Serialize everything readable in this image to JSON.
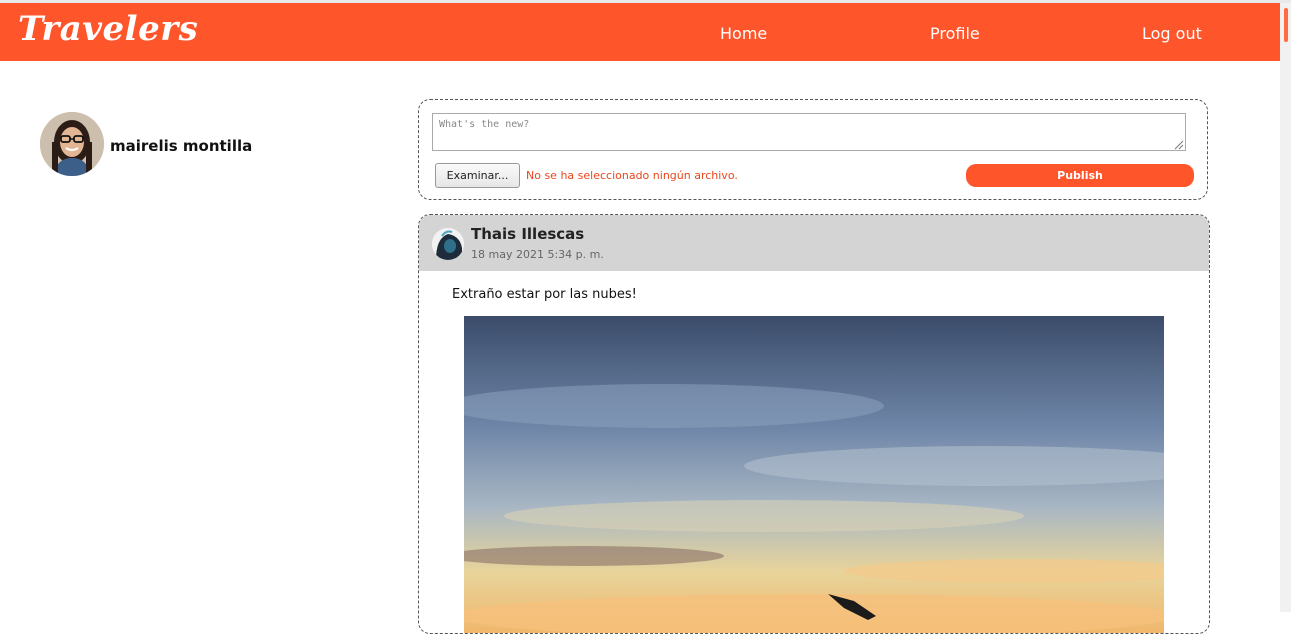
{
  "nav": {
    "logo": "Travelers",
    "home": "Home",
    "profile": "Profile",
    "logout": "Log out",
    "accent_color": "#ff552b"
  },
  "user": {
    "name": "mairelis montilla",
    "avatar_icon": "user-photo"
  },
  "composer": {
    "placeholder": "What's the new?",
    "file_button": "Examinar...",
    "file_status": "No se ha seleccionado ningún archivo.",
    "publish": "Publish"
  },
  "feed": {
    "posts": [
      {
        "author": "Thais Illescas",
        "date": "18 may 2021 5:34 p. m.",
        "text": "Extraño estar por las nubes!",
        "image": "sunset-sky-airplane-wing"
      }
    ]
  }
}
